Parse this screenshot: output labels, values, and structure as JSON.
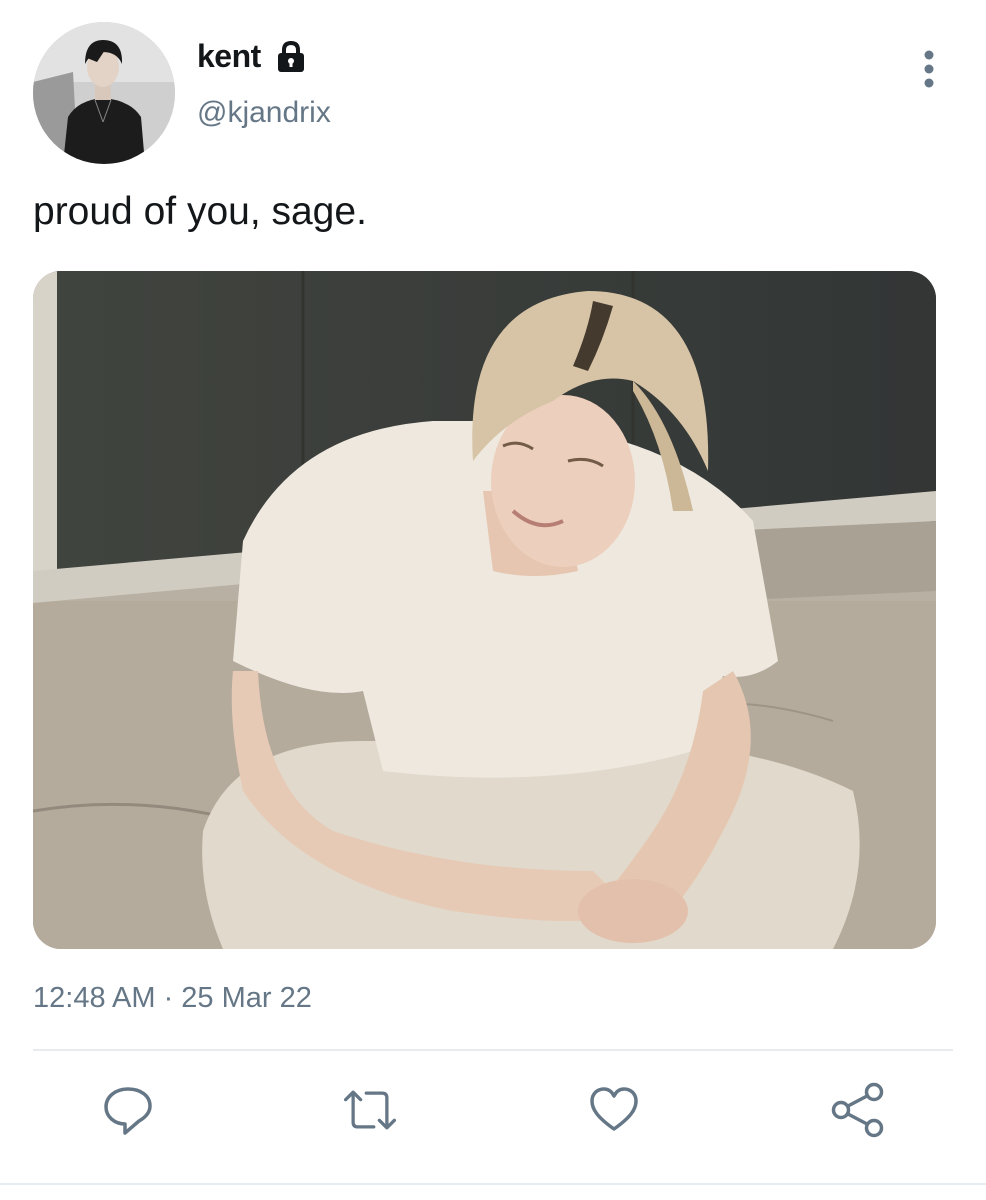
{
  "tweet": {
    "author": {
      "display_name": "kent",
      "handle": "@kjandrix",
      "protected_icon": "lock-icon",
      "avatar": "avatar-photo"
    },
    "text": "proud of you, sage.",
    "media": {
      "kind": "photo"
    },
    "timestamp": "12:48 AM · 25 Mar 22",
    "actions": [
      {
        "name": "reply",
        "icon": "comment-icon"
      },
      {
        "name": "retweet",
        "icon": "retweet-icon"
      },
      {
        "name": "like",
        "icon": "heart-icon"
      },
      {
        "name": "share",
        "icon": "share-icon"
      }
    ],
    "more_icon": "vertical-dots-icon"
  },
  "colors": {
    "text": "#14171a",
    "secondary": "#657786",
    "divider": "#e6ecf0",
    "icon": "#657786"
  }
}
